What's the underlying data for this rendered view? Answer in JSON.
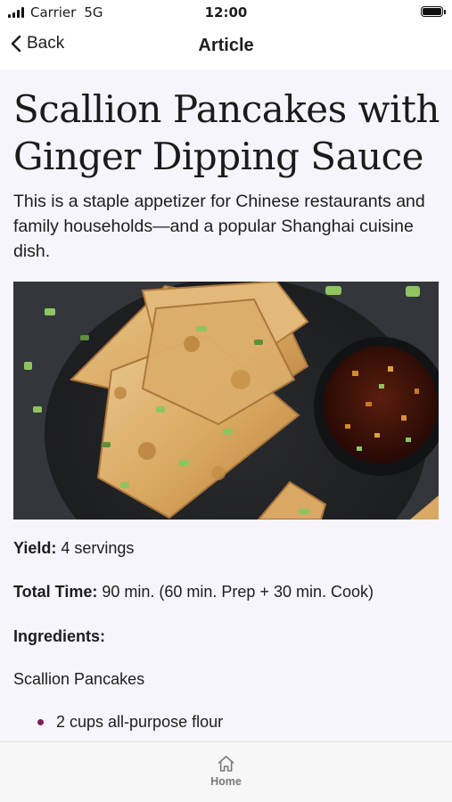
{
  "status_bar": {
    "carrier": "Carrier",
    "network": "5G",
    "time": "12:00"
  },
  "nav": {
    "back_label": "Back",
    "title": "Article"
  },
  "article": {
    "title": "Scallion Pancakes with Ginger Dipping Sauce",
    "intro": "This is a staple appetizer for Chinese restaurants and family households—and a popular Shanghai cuisine dish.",
    "hero_image": "scallion-pancakes-with-dipping-sauce-photo",
    "yield_label": "Yield:",
    "yield_value": "4 servings",
    "time_label": "Total Time:",
    "time_value": "90 min. (60 min. Prep + 30 min. Cook)",
    "ingredients_label": "Ingredients:",
    "ingredient_group": "Scallion Pancakes",
    "ingredients": [
      "2 cups all-purpose flour"
    ]
  },
  "tab_bar": {
    "home_label": "Home",
    "home_icon": "home-icon"
  },
  "colors": {
    "content_bg": "#f6f5fb",
    "bullet": "#7a1f5e",
    "tab_label": "#7a7a7a"
  }
}
